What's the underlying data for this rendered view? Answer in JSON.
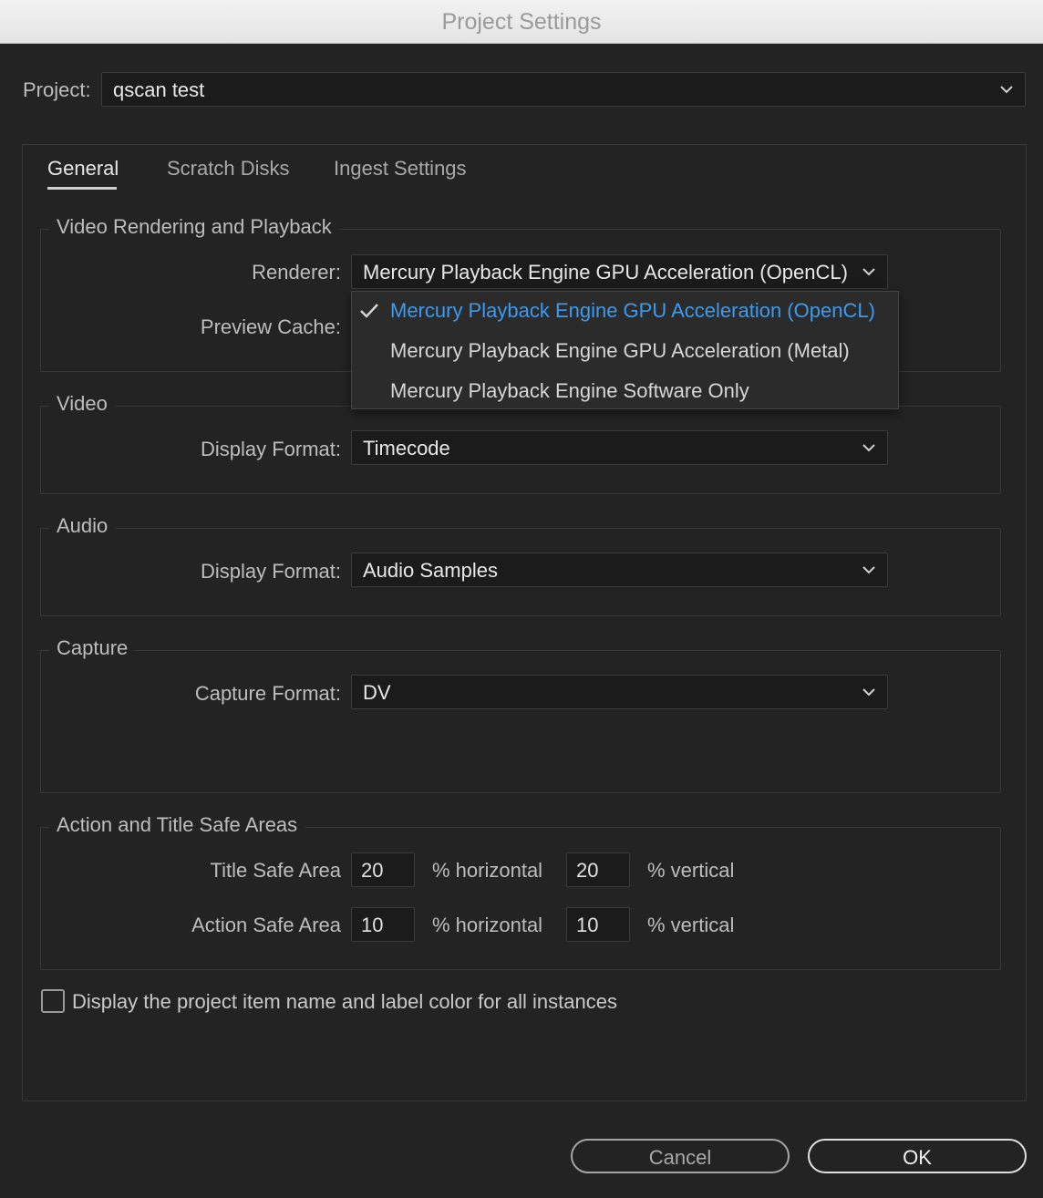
{
  "window": {
    "title": "Project Settings"
  },
  "project": {
    "label": "Project:",
    "value": "qscan test"
  },
  "tabs": [
    {
      "label": "General",
      "active": true
    },
    {
      "label": "Scratch Disks",
      "active": false
    },
    {
      "label": "Ingest Settings",
      "active": false
    }
  ],
  "video_rendering": {
    "legend": "Video Rendering and Playback",
    "renderer_label": "Renderer:",
    "renderer_value": "Mercury Playback Engine GPU Acceleration (OpenCL)",
    "preview_cache_label": "Preview Cache:",
    "renderer_options": [
      {
        "label": "Mercury Playback Engine GPU Acceleration (OpenCL)",
        "selected": true
      },
      {
        "label": "Mercury Playback Engine GPU Acceleration (Metal)",
        "selected": false
      },
      {
        "label": "Mercury Playback Engine Software Only",
        "selected": false
      }
    ]
  },
  "video": {
    "legend": "Video",
    "display_format_label": "Display Format:",
    "display_format_value": "Timecode"
  },
  "audio": {
    "legend": "Audio",
    "display_format_label": "Display Format:",
    "display_format_value": "Audio Samples"
  },
  "capture": {
    "legend": "Capture",
    "capture_format_label": "Capture Format:",
    "capture_format_value": "DV"
  },
  "safe_areas": {
    "legend": "Action and Title Safe Areas",
    "title_safe_label": "Title Safe Area",
    "title_horizontal": "20",
    "title_vertical": "20",
    "action_safe_label": "Action Safe Area",
    "action_horizontal": "10",
    "action_vertical": "10",
    "horizontal_unit": "% horizontal",
    "vertical_unit": "% vertical"
  },
  "display_checkbox": {
    "label": "Display the project item name and label color for all instances",
    "checked": false
  },
  "buttons": {
    "cancel": "Cancel",
    "ok": "OK"
  },
  "colors": {
    "background": "#232323",
    "accent_selected": "#3a9bf0"
  }
}
